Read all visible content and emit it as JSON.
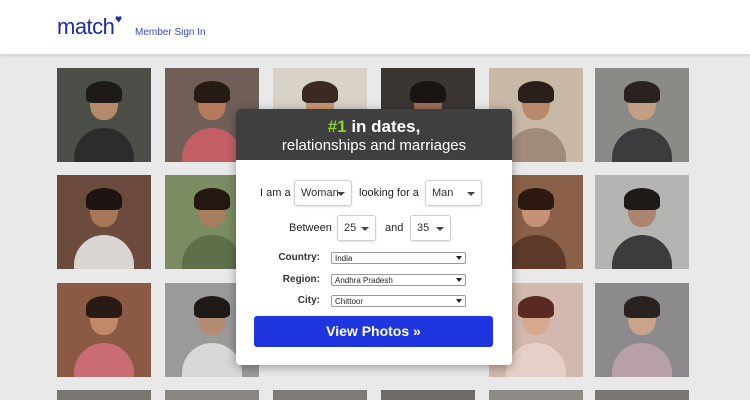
{
  "header": {
    "logo_text": "match",
    "logo_heart": "♥",
    "sign_in_label": "Member Sign In"
  },
  "modal": {
    "headline_accent": "#1",
    "headline_rest": " in dates,",
    "subheadline": "relationships and marriages",
    "i_am_label": "I am a",
    "i_am_value": "Woman",
    "looking_for_label": "looking for a",
    "looking_for_value": "Man",
    "between_label": "Between",
    "age_min": "25",
    "and_label": "and",
    "age_max": "35",
    "country_label": "Country:",
    "country_value": "India",
    "region_label": "Region:",
    "region_value": "Andhra Pradesh",
    "city_label": "City:",
    "city_value": "Chittoor",
    "cta_label": "View Photos »"
  },
  "colors": {
    "brand": "#1b2ca8",
    "accent_green": "#8bd22a",
    "cta_blue": "#1e35e0",
    "modal_header": "#3f3f3f"
  },
  "icons": [
    "heart-icon",
    "chevron-down-icon"
  ]
}
